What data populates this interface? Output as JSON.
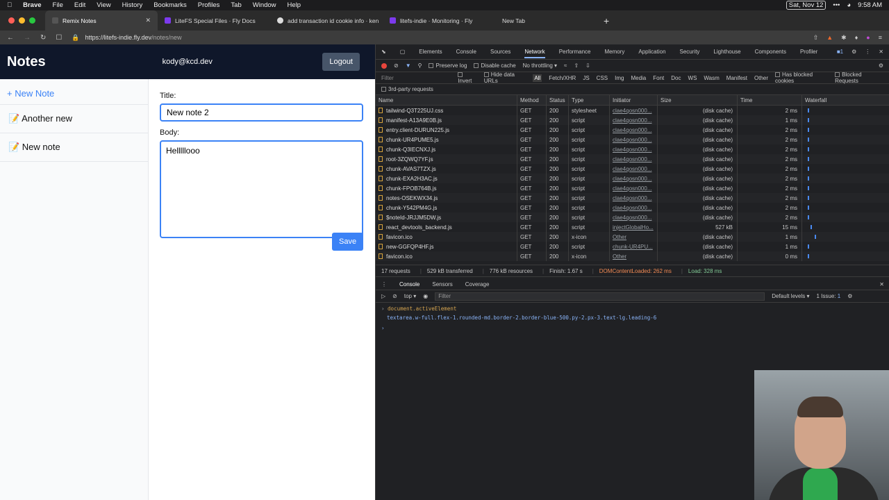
{
  "menubar": {
    "app": "Brave",
    "items": [
      "File",
      "Edit",
      "View",
      "History",
      "Bookmarks",
      "Profiles",
      "Tab",
      "Window",
      "Help"
    ],
    "date": "Sat, Nov 12",
    "time": "9:58 AM"
  },
  "tabs": [
    {
      "label": "Remix Notes",
      "active": true
    },
    {
      "label": "LiteFS Special Files · Fly Docs"
    },
    {
      "label": "add transaction id cookie info · ken"
    },
    {
      "label": "litefs-indie · Monitoring · Fly"
    },
    {
      "label": "New Tab"
    }
  ],
  "address": {
    "host": "https://litefs-indie.fly.dev",
    "path": "/notes/new"
  },
  "app": {
    "title": "Notes",
    "user": "kody@kcd.dev",
    "logout": "Logout",
    "new_note": "+ New Note",
    "notes": [
      "📝 Another new",
      "📝 New note"
    ],
    "title_label": "Title:",
    "title_value": "New note 2",
    "body_label": "Body:",
    "body_value": "Helllllooo",
    "save": "Save"
  },
  "devtools": {
    "tabs": [
      "Elements",
      "Console",
      "Sources",
      "Network",
      "Performance",
      "Memory",
      "Application",
      "Security",
      "Lighthouse",
      "Components",
      "Profiler"
    ],
    "active_tab": "Network",
    "preserve_log": "Preserve log",
    "disable_cache": "Disable cache",
    "throttling": "No throttling",
    "filter": "Filter",
    "invert": "Invert",
    "hide_data_urls": "Hide data URLs",
    "types": [
      "All",
      "Fetch/XHR",
      "JS",
      "CSS",
      "Img",
      "Media",
      "Font",
      "Doc",
      "WS",
      "Wasm",
      "Manifest",
      "Other"
    ],
    "has_blocked": "Has blocked cookies",
    "blocked_requests": "Blocked Requests",
    "third_party": "3rd-party requests",
    "columns": [
      "Name",
      "Method",
      "Status",
      "Type",
      "Initiator",
      "Size",
      "Time",
      "Waterfall"
    ],
    "rows": [
      {
        "name": "tailwind-Q3T225UJ.css",
        "method": "GET",
        "status": "200",
        "type": "stylesheet",
        "initiator": "clae4qosn000...",
        "size": "(disk cache)",
        "time": "2 ms"
      },
      {
        "name": "manifest-A13A9E0B.js",
        "method": "GET",
        "status": "200",
        "type": "script",
        "initiator": "clae4qosn000...",
        "size": "(disk cache)",
        "time": "1 ms"
      },
      {
        "name": "entry.client-DURUN225.js",
        "method": "GET",
        "status": "200",
        "type": "script",
        "initiator": "clae4qosn000...",
        "size": "(disk cache)",
        "time": "2 ms"
      },
      {
        "name": "chunk-UR4PUME5.js",
        "method": "GET",
        "status": "200",
        "type": "script",
        "initiator": "clae4qosn000...",
        "size": "(disk cache)",
        "time": "2 ms"
      },
      {
        "name": "chunk-Q3IECNXJ.js",
        "method": "GET",
        "status": "200",
        "type": "script",
        "initiator": "clae4qosn000...",
        "size": "(disk cache)",
        "time": "2 ms"
      },
      {
        "name": "root-3ZQWQ7YF.js",
        "method": "GET",
        "status": "200",
        "type": "script",
        "initiator": "clae4qosn000...",
        "size": "(disk cache)",
        "time": "2 ms"
      },
      {
        "name": "chunk-AVAS7TZX.js",
        "method": "GET",
        "status": "200",
        "type": "script",
        "initiator": "clae4qosn000...",
        "size": "(disk cache)",
        "time": "2 ms"
      },
      {
        "name": "chunk-EXA2H3AC.js",
        "method": "GET",
        "status": "200",
        "type": "script",
        "initiator": "clae4qosn000...",
        "size": "(disk cache)",
        "time": "2 ms"
      },
      {
        "name": "chunk-FPOB764B.js",
        "method": "GET",
        "status": "200",
        "type": "script",
        "initiator": "clae4qosn000...",
        "size": "(disk cache)",
        "time": "2 ms"
      },
      {
        "name": "notes-OSEKWX34.js",
        "method": "GET",
        "status": "200",
        "type": "script",
        "initiator": "clae4qosn000...",
        "size": "(disk cache)",
        "time": "2 ms"
      },
      {
        "name": "chunk-Y542PM4G.js",
        "method": "GET",
        "status": "200",
        "type": "script",
        "initiator": "clae4qosn000...",
        "size": "(disk cache)",
        "time": "2 ms"
      },
      {
        "name": "$noteId-JRJJM5DW.js",
        "method": "GET",
        "status": "200",
        "type": "script",
        "initiator": "clae4qosn000...",
        "size": "(disk cache)",
        "time": "2 ms"
      },
      {
        "name": "react_devtools_backend.js",
        "method": "GET",
        "status": "200",
        "type": "script",
        "initiator": "injectGlobalHo...",
        "size": "527 kB",
        "time": "15 ms"
      },
      {
        "name": "favicon.ico",
        "method": "GET",
        "status": "200",
        "type": "x-icon",
        "initiator": "Other",
        "size": "(disk cache)",
        "time": "1 ms"
      },
      {
        "name": "new-GGFQP4HF.js",
        "method": "GET",
        "status": "200",
        "type": "script",
        "initiator": "chunk-UR4PU...",
        "size": "(disk cache)",
        "time": "1 ms"
      },
      {
        "name": "favicon.ico",
        "method": "GET",
        "status": "200",
        "type": "x-icon",
        "initiator": "Other",
        "size": "(disk cache)",
        "time": "0 ms"
      }
    ],
    "summary": {
      "requests": "17 requests",
      "transferred": "529 kB transferred",
      "resources": "776 kB resources",
      "finish": "Finish: 1.67 s",
      "dcl": "DOMContentLoaded: 262 ms",
      "load": "Load: 328 ms"
    },
    "drawer_tabs": [
      "Console",
      "Sensors",
      "Coverage"
    ],
    "console_context": "top",
    "console_filter": "Filter",
    "default_levels": "Default levels",
    "issues": "1 Issue:",
    "issue_count": "1",
    "console_cmd": "document.activeElement",
    "console_result": "textarea.w-full.flex-1.rounded-md.border-2.border-blue-500.py-2.px-3.text-lg.leading-6"
  },
  "colors": {
    "accent": "#3b82f6",
    "header": "#0f172a",
    "devtools_bg": "#202124"
  }
}
